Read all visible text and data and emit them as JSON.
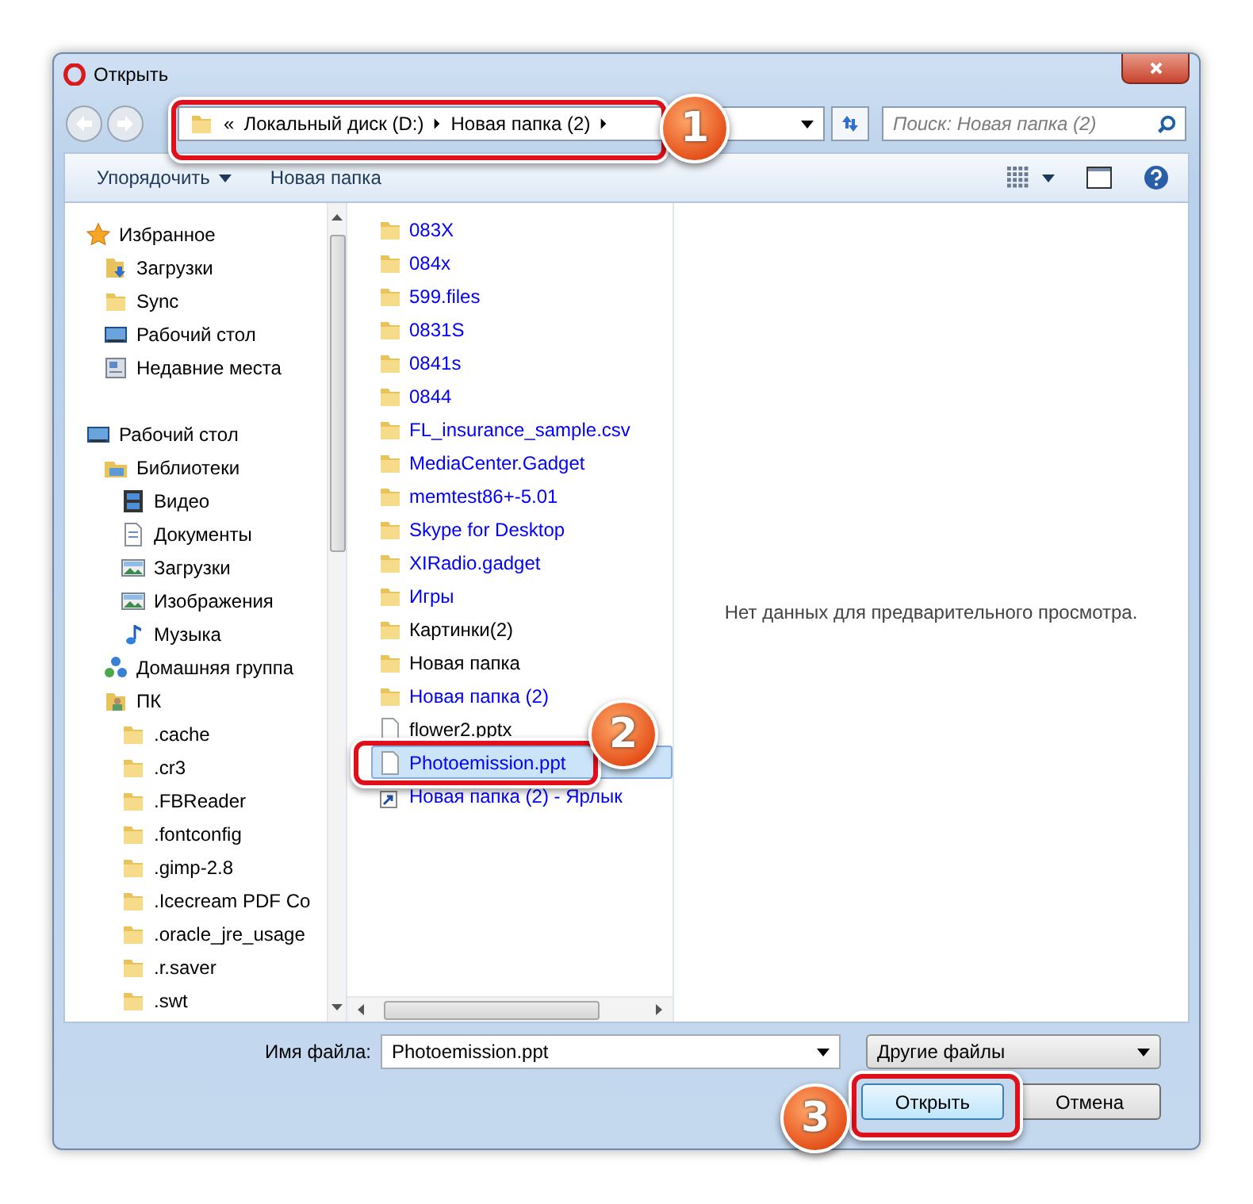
{
  "window": {
    "title": "Открыть"
  },
  "address": {
    "overflow": "«",
    "segments": [
      "Локальный диск (D:)",
      "Новая папка (2)"
    ]
  },
  "search": {
    "placeholder": "Поиск: Новая папка (2)"
  },
  "toolbar": {
    "organize": "Упорядочить",
    "new_folder": "Новая папка"
  },
  "navigation": [
    {
      "label": "Избранное",
      "kind": "star",
      "children": [
        {
          "label": "Загрузки",
          "kind": "downloads"
        },
        {
          "label": "Sync",
          "kind": "folder"
        },
        {
          "label": "Рабочий стол",
          "kind": "desktop"
        },
        {
          "label": "Недавние места",
          "kind": "recent"
        }
      ]
    },
    {
      "label": "Рабочий стол",
      "kind": "desktop",
      "children": [
        {
          "label": "Библиотеки",
          "kind": "library",
          "children": [
            {
              "label": "Видео",
              "kind": "video"
            },
            {
              "label": "Документы",
              "kind": "document"
            },
            {
              "label": "Загрузки",
              "kind": "image"
            },
            {
              "label": "Изображения",
              "kind": "image"
            },
            {
              "label": "Музыка",
              "kind": "music"
            }
          ]
        },
        {
          "label": "Домашняя группа",
          "kind": "homegroup"
        },
        {
          "label": "ПК",
          "kind": "pc",
          "children": [
            {
              "label": ".cache",
              "kind": "folder"
            },
            {
              "label": ".cr3",
              "kind": "folder"
            },
            {
              "label": ".FBReader",
              "kind": "folder"
            },
            {
              "label": ".fontconfig",
              "kind": "folder"
            },
            {
              "label": ".gimp-2.8",
              "kind": "folder"
            },
            {
              "label": ".Icecream PDF Co",
              "kind": "folder"
            },
            {
              "label": ".oracle_jre_usage",
              "kind": "folder"
            },
            {
              "label": ".r.saver",
              "kind": "folder"
            },
            {
              "label": ".swt",
              "kind": "folder"
            }
          ]
        }
      ]
    }
  ],
  "files": [
    {
      "name": "083X",
      "kind": "folder",
      "color": "#0000ff",
      "selected": false
    },
    {
      "name": "084x",
      "kind": "folder",
      "color": "#0000ff",
      "selected": false
    },
    {
      "name": "599.files",
      "kind": "folder",
      "color": "#0000ff",
      "selected": false
    },
    {
      "name": "0831S",
      "kind": "folder",
      "color": "#0000ff",
      "selected": false
    },
    {
      "name": "0841s",
      "kind": "folder",
      "color": "#0000ff",
      "selected": false
    },
    {
      "name": "0844",
      "kind": "folder",
      "color": "#0000ff",
      "selected": false
    },
    {
      "name": "FL_insurance_sample.csv",
      "kind": "folder",
      "color": "#0000ff",
      "selected": false
    },
    {
      "name": "MediaCenter.Gadget",
      "kind": "folder",
      "color": "#0000ff",
      "selected": false
    },
    {
      "name": "memtest86+-5.01",
      "kind": "folder",
      "color": "#0000ff",
      "selected": false
    },
    {
      "name": "Skype for Desktop",
      "kind": "folder",
      "color": "#0000ff",
      "selected": false
    },
    {
      "name": "XIRadio.gadget",
      "kind": "folder",
      "color": "#0000ff",
      "selected": false
    },
    {
      "name": "Игры",
      "kind": "folder",
      "color": "#0000ff",
      "selected": false
    },
    {
      "name": "Картинки(2)",
      "kind": "folder",
      "color": "#000000",
      "selected": false
    },
    {
      "name": "Новая папка",
      "kind": "folder",
      "color": "#000000",
      "selected": false
    },
    {
      "name": "Новая папка (2)",
      "kind": "folder",
      "color": "#0000ff",
      "selected": false
    },
    {
      "name": "flower2.pptx",
      "kind": "file",
      "color": "#000000",
      "selected": false
    },
    {
      "name": "Photoemission.ppt",
      "kind": "file",
      "color": "#0000ff",
      "selected": true
    },
    {
      "name": "Новая папка (2) - Ярлык",
      "kind": "shortcut",
      "color": "#0000ff",
      "selected": false
    }
  ],
  "preview": {
    "message": "Нет данных для предварительного просмотра."
  },
  "filename": {
    "label": "Имя файла:",
    "value": "Photoemission.ppt"
  },
  "filetype": {
    "value": "Другие файлы"
  },
  "buttons": {
    "open": "Открыть",
    "cancel": "Отмена"
  },
  "callouts": [
    {
      "number": "1",
      "kind": "address"
    },
    {
      "number": "2",
      "kind": "file"
    },
    {
      "number": "3",
      "kind": "open"
    }
  ]
}
